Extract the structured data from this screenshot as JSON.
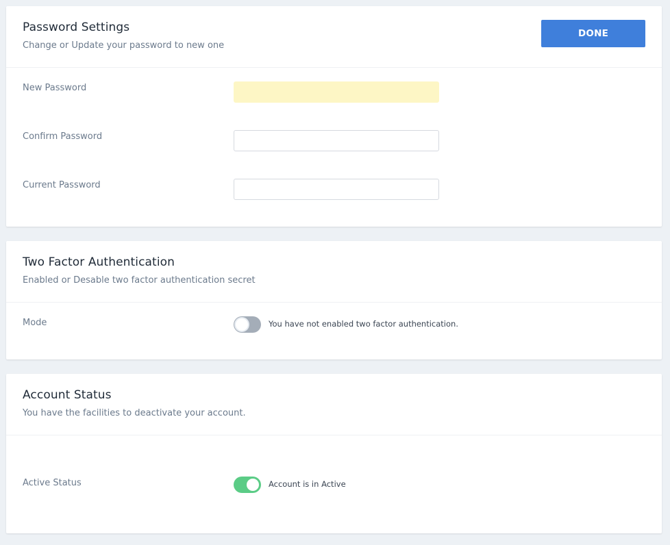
{
  "password_settings": {
    "title": "Password Settings",
    "subtitle": "Change or Update your password to new one",
    "done_label": "DONE",
    "fields": [
      {
        "label": "New Password",
        "value": ""
      },
      {
        "label": "Confirm Password",
        "value": ""
      },
      {
        "label": "Current Password",
        "value": ""
      }
    ]
  },
  "two_factor": {
    "title": "Two Factor Authentication",
    "subtitle": "Enabled or Desable two factor authentication secret",
    "mode_label": "Mode",
    "enabled": false,
    "status_text": "You have not enabled two factor authentication."
  },
  "account_status": {
    "title": "Account Status",
    "subtitle": "You have the facilities to deactivate your account.",
    "active_label": "Active Status",
    "active": true,
    "status_text": "Account is in Active"
  },
  "colors": {
    "primary": "#3f7fdb",
    "toggle_on": "#5bcc86",
    "toggle_off": "#a4adb8",
    "autofill": "#fdf6c5"
  }
}
